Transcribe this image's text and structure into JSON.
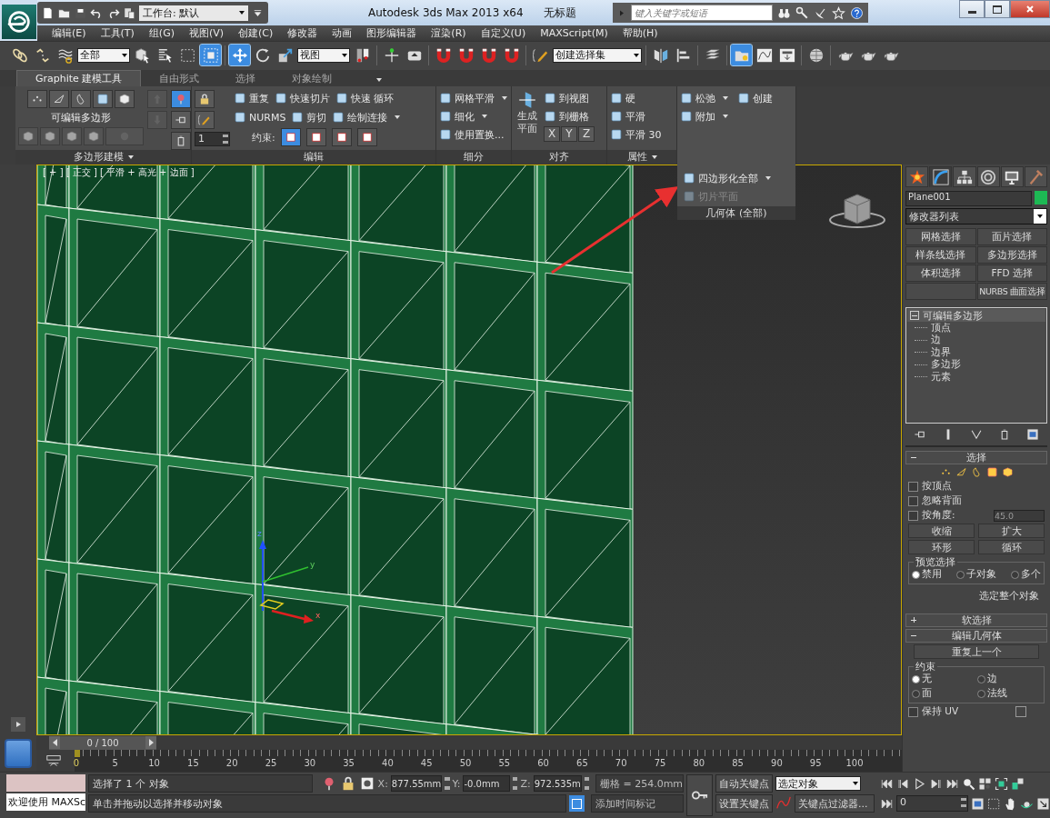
{
  "title_bar": {
    "workspace": "工作台: 默认",
    "app_title": "Autodesk 3ds Max  2013 x64",
    "document": "无标题",
    "search": {
      "placeholder": "键入关键字或短语"
    }
  },
  "menu": [
    "编辑(E)",
    "工具(T)",
    "组(G)",
    "视图(V)",
    "创建(C)",
    "修改器",
    "动画",
    "图形编辑器",
    "渲染(R)",
    "自定义(U)",
    "MAXScript(M)",
    "帮助(H)"
  ],
  "toolbar": {
    "selection_filter": "全部",
    "coordinate_system": "视图",
    "named_selection": "创建选择集",
    "buttons": [
      {
        "selected": false
      },
      {
        "selected": false
      },
      {
        "selected": false
      },
      {
        "selected": false
      },
      {
        "selected": false
      },
      {
        "selected": false
      },
      {
        "selected": true
      },
      {
        "selected": true
      },
      {
        "selected": false
      },
      {
        "selected": false
      },
      {
        "selected": false
      },
      {
        "selected": false
      },
      {
        "selected": false
      },
      {
        "selected": false
      },
      {
        "selected": false
      },
      {
        "selected": false
      },
      {
        "selected": false
      },
      {
        "selected": false
      },
      {
        "selected": false
      },
      {
        "selected": false
      },
      {
        "selected": false
      },
      {
        "selected": true
      },
      {
        "selected": false
      },
      {
        "selected": false
      },
      {
        "selected": false
      },
      {
        "selected": false
      },
      {
        "selected": false
      },
      {
        "selected": false
      }
    ]
  },
  "ribbon": {
    "tabs": [
      {
        "label": "Graphite 建模工具",
        "selected": true
      },
      {
        "label": "自由形式",
        "selected": false
      },
      {
        "label": "选择",
        "selected": false
      },
      {
        "label": "对象绘制",
        "selected": false
      }
    ],
    "panels": [
      {
        "kind": "poly",
        "title": "多边形建模",
        "menu": true,
        "label": "可编辑多边形"
      },
      {
        "kind": "edit",
        "title": "编辑",
        "menu": false,
        "spinner": "1",
        "rows": [
          [
            {
              "label": "重复",
              "dropdown": false
            },
            {
              "label": "快速切片",
              "dropdown": false
            },
            {
              "label": "快速 循环",
              "dropdown": false
            }
          ],
          [
            {
              "label": "NURMS",
              "dropdown": false
            },
            {
              "label": "剪切",
              "dropdown": false
            },
            {
              "label": "绘制连接",
              "dropdown": true
            }
          ]
        ],
        "constraint_label": "约束:",
        "constraints": [
          {
            "selected": true
          },
          {
            "selected": false
          },
          {
            "selected": false
          },
          {
            "selected": false
          }
        ]
      },
      {
        "kind": "list",
        "title": "细分",
        "menu": false,
        "items": [
          {
            "label": "网格平滑",
            "dropdown": true
          },
          {
            "label": "细化",
            "dropdown": true
          },
          {
            "label": "使用置换...",
            "dropdown": false
          }
        ]
      },
      {
        "kind": "align",
        "title": "对齐",
        "menu": false,
        "big_button": "生成平面",
        "items": [
          {
            "label": "到视图",
            "dropdown": false
          },
          {
            "label": "到栅格",
            "dropdown": false
          }
        ],
        "axes": [
          "X",
          "Y",
          "Z"
        ]
      },
      {
        "kind": "list",
        "title": "属性",
        "menu": true,
        "items": [
          {
            "label": "硬",
            "dropdown": false
          },
          {
            "label": "平滑",
            "dropdown": false
          },
          {
            "label": "平滑 30",
            "dropdown": false
          }
        ]
      },
      {
        "kind": "geometry",
        "menu": false,
        "items": [
          {
            "label": "松弛",
            "dropdown": true
          },
          {
            "label": "创建",
            "dropdown": false
          },
          {
            "label": "附加",
            "dropdown": true
          }
        ],
        "flyout": {
          "items": [
            {
              "label": "四边形化全部",
              "dropdown": true,
              "disabled": false
            },
            {
              "label": "切片平面",
              "dropdown": false,
              "disabled": true
            }
          ],
          "footer": "几何体 (全部)"
        }
      }
    ]
  },
  "viewport": {
    "label": "[ + ] [ 正交 ] [ 平滑 + 高光 + 边面 ]",
    "gizmo_axes": [
      "z",
      "y",
      "x"
    ]
  },
  "command_tabs": [
    {
      "selected": false
    },
    {
      "selected": true
    },
    {
      "selected": false
    },
    {
      "selected": false
    },
    {
      "selected": false
    },
    {
      "selected": false
    }
  ],
  "object": {
    "name": "Plane001",
    "color": "#1db954"
  },
  "modifier_list": "修改器列表",
  "modifier_buttons": [
    [
      "网格选择",
      "面片选择"
    ],
    [
      "样条线选择",
      "多边形选择"
    ],
    [
      "体积选择",
      "FFD 选择"
    ],
    [
      "NURBS 曲面选择"
    ]
  ],
  "stack": [
    {
      "label": "可编辑多边形",
      "expanded": true,
      "children": [
        {
          "label": "顶点"
        },
        {
          "label": "边"
        },
        {
          "label": "边界"
        },
        {
          "label": "多边形"
        },
        {
          "label": "元素"
        }
      ]
    }
  ],
  "rollouts": [
    {
      "kind": "selection",
      "title": "选择",
      "expanded": true,
      "checkboxes": [
        {
          "label": "按顶点",
          "checked": false
        },
        {
          "label": "忽略背面",
          "checked": false
        },
        {
          "label": "按角度:",
          "checked": false
        }
      ],
      "angle": "45.0",
      "buttons": [
        "收缩",
        "扩大"
      ],
      "spin_buttons": [
        "环形",
        "循环"
      ],
      "preview": {
        "title": "预览选择",
        "options": [
          {
            "label": "禁用",
            "selected": true
          },
          {
            "label": "子对象",
            "selected": false
          },
          {
            "label": "多个",
            "selected": false
          }
        ]
      },
      "status": "选定整个对象"
    },
    {
      "title": "软选择",
      "expanded": false
    },
    {
      "kind": "geometry",
      "title": "编辑几何体",
      "expanded": true,
      "repeat": "重复上一个",
      "constraints": {
        "title": "约束",
        "options": [
          {
            "label": "无",
            "selected": true
          },
          {
            "label": "边",
            "selected": false
          },
          {
            "label": "面",
            "selected": false
          },
          {
            "label": "法线",
            "selected": false
          }
        ]
      },
      "preserve_uv": {
        "label": "保持 UV",
        "checked": false
      }
    }
  ],
  "timeline": {
    "slider": "0 / 100",
    "level": 0,
    "ticks": [
      "0",
      "5",
      "10",
      "15",
      "20",
      "25",
      "30",
      "35",
      "40",
      "45",
      "50",
      "55",
      "60",
      "65",
      "70",
      "75",
      "80",
      "85",
      "90",
      "95",
      "100"
    ]
  },
  "status_bar": {
    "listener_text": "欢迎使用 MAXSc",
    "status": "选择了 1 个 对象",
    "prompt": "单击并拖动以选择并移动对象",
    "coordinates": [
      {
        "label": "X:",
        "value": "877.55mm"
      },
      {
        "label": "Y:",
        "value": "-0.0mm"
      },
      {
        "label": "Z:",
        "value": "972.535m"
      }
    ],
    "grid": "栅格 = 254.0mm",
    "time_tag": "添加时间标记",
    "auto_key": "自动关键点",
    "set_key": "设置关键点",
    "key_mode": "选定对象",
    "key_filters": "关键点过滤器...",
    "frame": "0"
  }
}
